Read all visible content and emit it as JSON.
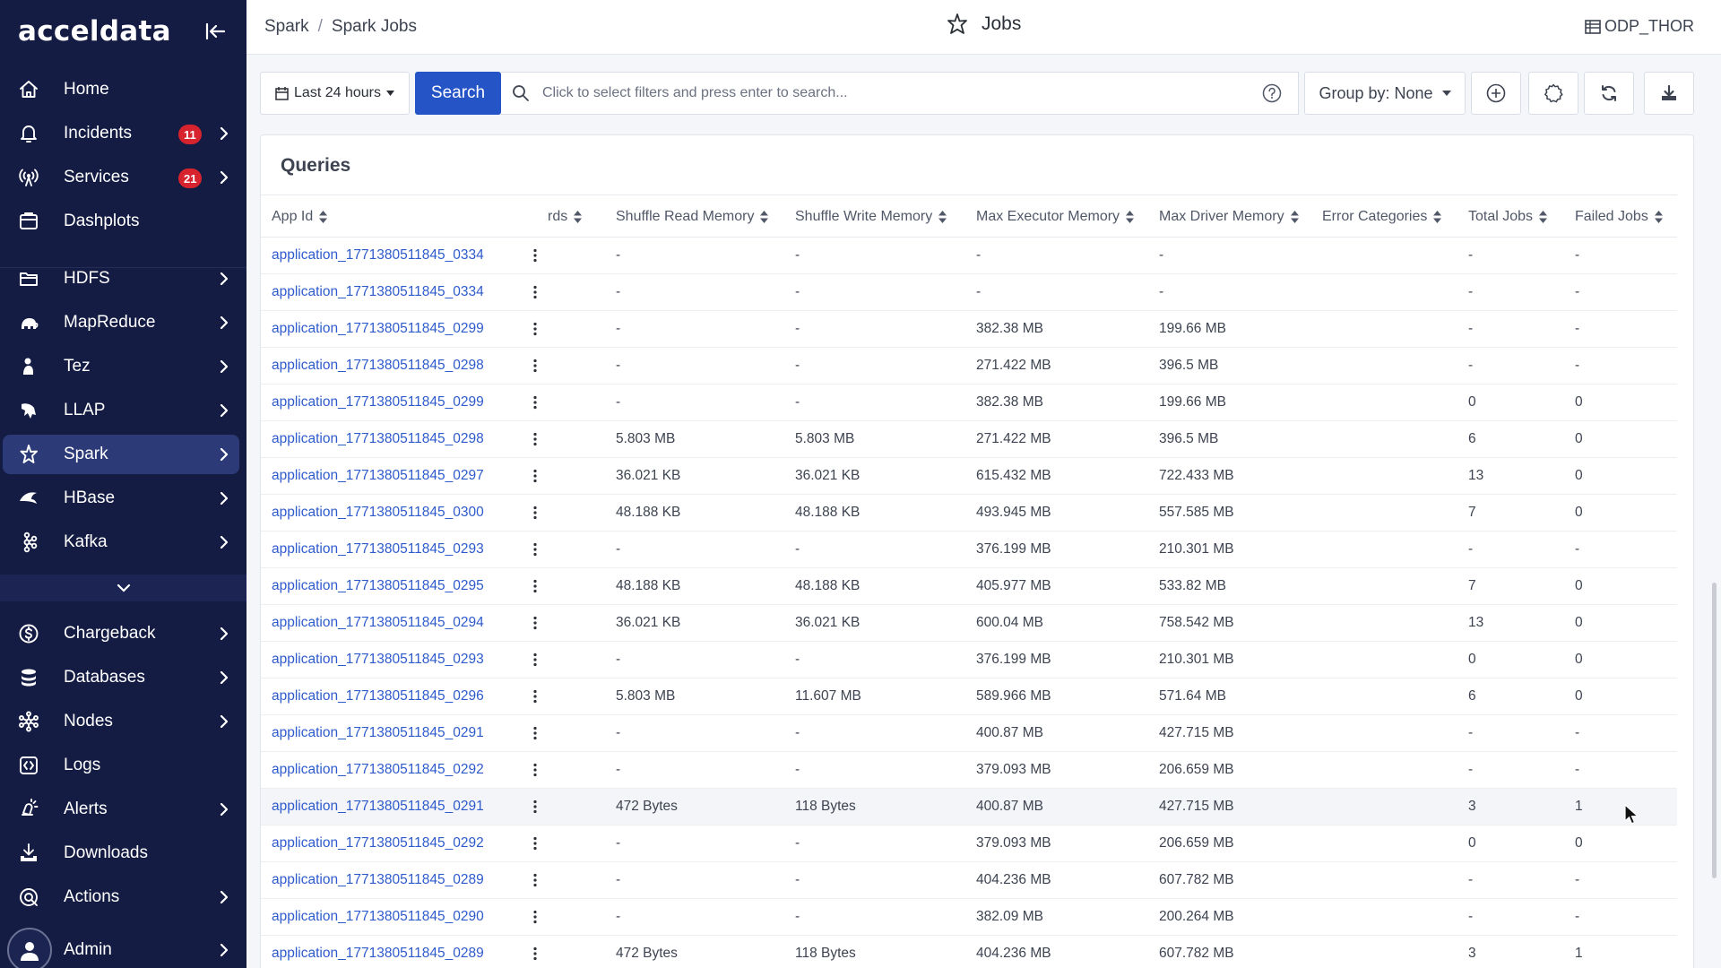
{
  "app": {
    "logo": "acceldata"
  },
  "sidebar": {
    "items": [
      {
        "key": "home",
        "label": "Home",
        "icon": "home-icon",
        "badge": "",
        "chevron": false
      },
      {
        "key": "incidents",
        "label": "Incidents",
        "icon": "bell-icon",
        "badge": "11",
        "chevron": true
      },
      {
        "key": "services",
        "label": "Services",
        "icon": "broadcast-icon",
        "badge": "21",
        "chevron": true
      },
      {
        "key": "dashplots",
        "label": "Dashplots",
        "icon": "dashboard-icon",
        "badge": "",
        "chevron": false
      },
      {
        "key": "hdfs",
        "label": "HDFS",
        "icon": "folder-icon",
        "badge": "",
        "chevron": true
      },
      {
        "key": "mapreduce",
        "label": "MapReduce",
        "icon": "elephant-icon",
        "badge": "",
        "chevron": true
      },
      {
        "key": "tez",
        "label": "Tez",
        "icon": "tez-icon",
        "badge": "",
        "chevron": true
      },
      {
        "key": "llap",
        "label": "LLAP",
        "icon": "llap-icon",
        "badge": "",
        "chevron": true
      },
      {
        "key": "spark",
        "label": "Spark",
        "icon": "spark-icon",
        "badge": "",
        "chevron": true,
        "active": true
      },
      {
        "key": "hbase",
        "label": "HBase",
        "icon": "hbase-icon",
        "badge": "",
        "chevron": true
      },
      {
        "key": "kafka",
        "label": "Kafka",
        "icon": "kafka-icon",
        "badge": "",
        "chevron": true
      },
      {
        "key": "chargeback",
        "label": "Chargeback",
        "icon": "dollar-icon",
        "badge": "",
        "chevron": true
      },
      {
        "key": "databases",
        "label": "Databases",
        "icon": "database-icon",
        "badge": "",
        "chevron": true
      },
      {
        "key": "nodes",
        "label": "Nodes",
        "icon": "nodes-icon",
        "badge": "",
        "chevron": true
      },
      {
        "key": "logs",
        "label": "Logs",
        "icon": "logs-icon",
        "badge": "",
        "chevron": false
      },
      {
        "key": "alerts",
        "label": "Alerts",
        "icon": "alert-icon",
        "badge": "",
        "chevron": true
      },
      {
        "key": "downloads",
        "label": "Downloads",
        "icon": "download-icon",
        "badge": "",
        "chevron": false
      },
      {
        "key": "actions",
        "label": "Actions",
        "icon": "actions-icon",
        "badge": "",
        "chevron": true
      },
      {
        "key": "admin",
        "label": "Admin",
        "icon": "user-avatar-icon",
        "badge": "",
        "chevron": true
      }
    ]
  },
  "header": {
    "breadcrumb": [
      "Spark",
      "Spark Jobs"
    ],
    "title": "Jobs",
    "cluster": "ODP_THOR"
  },
  "toolbar": {
    "date_range": "Last 24 hours",
    "search_label": "Search",
    "search_placeholder": "Click to select filters and press enter to search...",
    "group_by": "Group by: None"
  },
  "queries": {
    "title": "Queries",
    "columns": [
      "App Id",
      "rds",
      "Shuffle Read Memory",
      "Shuffle Write Memory",
      "Max Executor Memory",
      "Max Driver Memory",
      "Error Categories",
      "Total Jobs",
      "Failed Jobs"
    ],
    "rows": [
      [
        "application_1771380511845_0334",
        "-",
        "-",
        "-",
        "-",
        "",
        "-",
        "-"
      ],
      [
        "application_1771380511845_0334",
        "-",
        "-",
        "-",
        "-",
        "",
        "-",
        "-"
      ],
      [
        "application_1771380511845_0299",
        "-",
        "-",
        "382.38 MB",
        "199.66 MB",
        "",
        "-",
        "-"
      ],
      [
        "application_1771380511845_0298",
        "-",
        "-",
        "271.422 MB",
        "396.5 MB",
        "",
        "-",
        "-"
      ],
      [
        "application_1771380511845_0299",
        "-",
        "-",
        "382.38 MB",
        "199.66 MB",
        "",
        "0",
        "0"
      ],
      [
        "application_1771380511845_0298",
        "5.803 MB",
        "5.803 MB",
        "271.422 MB",
        "396.5 MB",
        "",
        "6",
        "0"
      ],
      [
        "application_1771380511845_0297",
        "36.021 KB",
        "36.021 KB",
        "615.432 MB",
        "722.433 MB",
        "",
        "13",
        "0"
      ],
      [
        "application_1771380511845_0300",
        "48.188 KB",
        "48.188 KB",
        "493.945 MB",
        "557.585 MB",
        "",
        "7",
        "0"
      ],
      [
        "application_1771380511845_0293",
        "-",
        "-",
        "376.199 MB",
        "210.301 MB",
        "",
        "-",
        "-"
      ],
      [
        "application_1771380511845_0295",
        "48.188 KB",
        "48.188 KB",
        "405.977 MB",
        "533.82 MB",
        "",
        "7",
        "0"
      ],
      [
        "application_1771380511845_0294",
        "36.021 KB",
        "36.021 KB",
        "600.04 MB",
        "758.542 MB",
        "",
        "13",
        "0"
      ],
      [
        "application_1771380511845_0293",
        "-",
        "-",
        "376.199 MB",
        "210.301 MB",
        "",
        "0",
        "0"
      ],
      [
        "application_1771380511845_0296",
        "5.803 MB",
        "11.607 MB",
        "589.966 MB",
        "571.64 MB",
        "",
        "6",
        "0"
      ],
      [
        "application_1771380511845_0291",
        "-",
        "-",
        "400.87 MB",
        "427.715 MB",
        "",
        "-",
        "-"
      ],
      [
        "application_1771380511845_0292",
        "-",
        "-",
        "379.093 MB",
        "206.659 MB",
        "",
        "-",
        "-"
      ],
      [
        "application_1771380511845_0291",
        "472 Bytes",
        "118 Bytes",
        "400.87 MB",
        "427.715 MB",
        "",
        "3",
        "1"
      ],
      [
        "application_1771380511845_0292",
        "-",
        "-",
        "379.093 MB",
        "206.659 MB",
        "",
        "0",
        "0"
      ],
      [
        "application_1771380511845_0289",
        "-",
        "-",
        "404.236 MB",
        "607.782 MB",
        "",
        "-",
        "-"
      ],
      [
        "application_1771380511845_0290",
        "-",
        "-",
        "382.09 MB",
        "200.264 MB",
        "",
        "-",
        "-"
      ],
      [
        "application_1771380511845_0289",
        "472 Bytes",
        "118 Bytes",
        "404.236 MB",
        "607.782 MB",
        "",
        "3",
        "1"
      ]
    ]
  },
  "colors": {
    "sidebar_bg": "#141c44",
    "active_bg": "#2c3a78",
    "badge": "#d7232e",
    "primary": "#2554c7",
    "link": "#2e5bcc"
  }
}
